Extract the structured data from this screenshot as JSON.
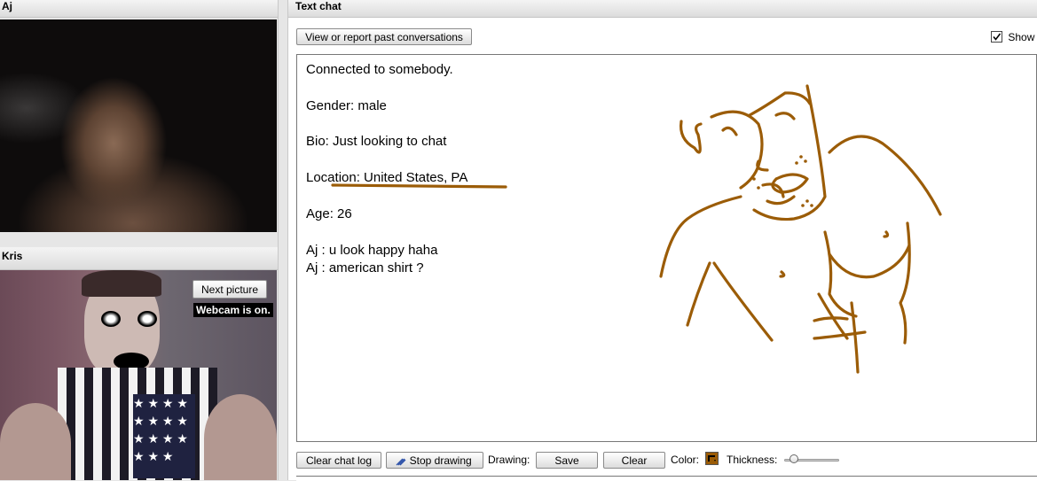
{
  "left_panels": {
    "top": {
      "name": "Aj"
    },
    "bottom": {
      "name": "Kris",
      "next_picture": "Next picture",
      "webcam_status": "Webcam is on."
    }
  },
  "chat": {
    "title": "Text chat",
    "view_report_button": "View or report past conversations",
    "show_label": "Show",
    "show_checked": true,
    "messages": {
      "connected": "Connected to somebody.",
      "gender": "Gender: male",
      "bio": "Bio: Just looking to chat",
      "location": "Location: United States, PA",
      "age": "Age: 26",
      "line1": "Aj : u look happy haha",
      "line2": "Aj : american shirt ?"
    },
    "drawing_color": "#9b5c07"
  },
  "toolbar": {
    "clear_chat_log": "Clear chat log",
    "stop_drawing": "Stop drawing",
    "drawing_label": "Drawing:",
    "save": "Save",
    "clear": "Clear",
    "color_label": "Color:",
    "thickness_label": "Thickness:",
    "thickness_value": 0.12
  },
  "icons": {
    "checkbox": "checkmark-icon",
    "pen": "pen-icon",
    "color_swatch": "color-swatch-icon"
  }
}
